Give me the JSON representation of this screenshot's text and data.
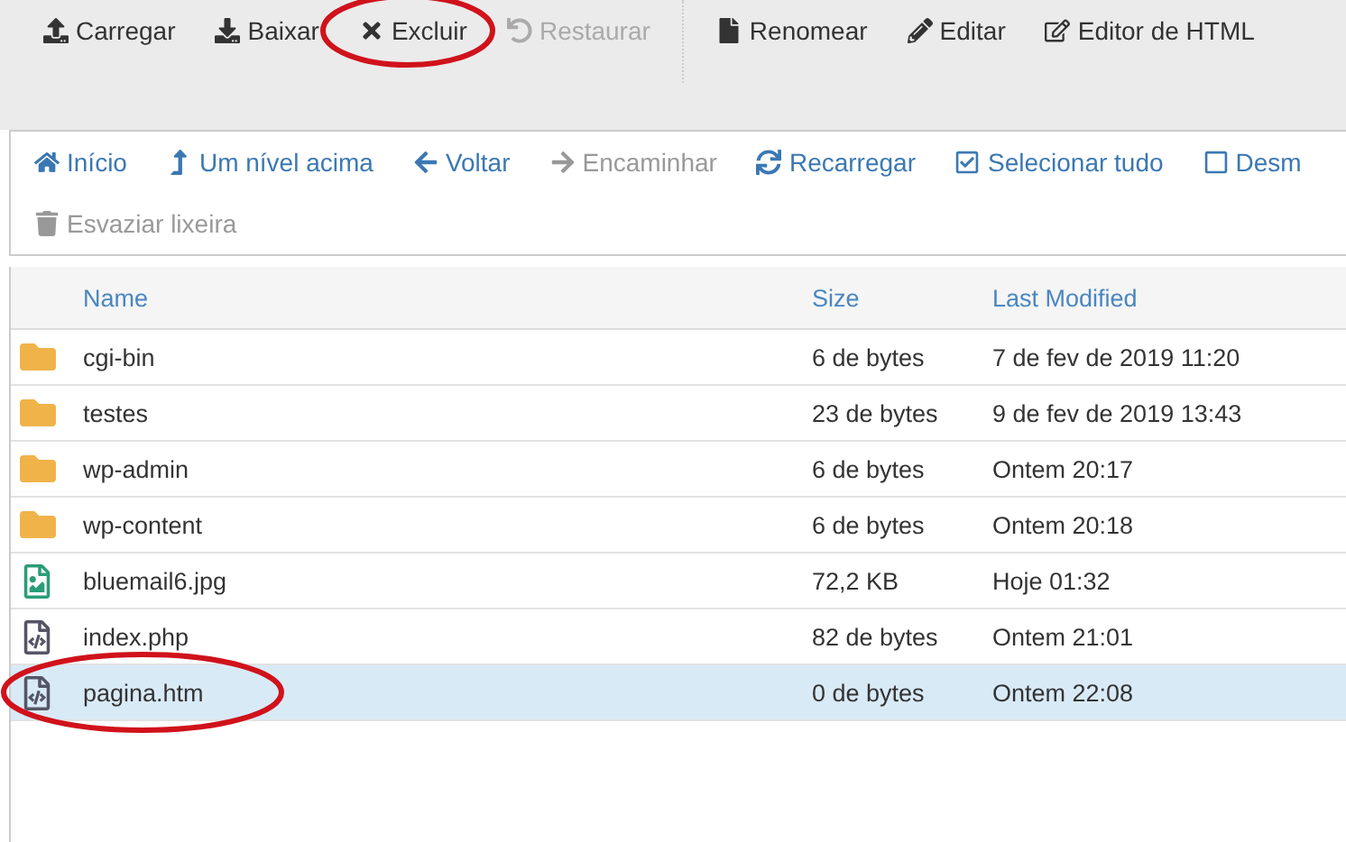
{
  "toolbar": [
    {
      "label": "Carregar",
      "disabled": false,
      "circled": false
    },
    {
      "label": "Baixar",
      "disabled": false,
      "circled": false
    },
    {
      "label": "Excluir",
      "disabled": false,
      "circled": true
    },
    {
      "label": "Restaurar",
      "disabled": true,
      "circled": false
    },
    {
      "label": "Renomear",
      "disabled": false,
      "circled": false
    },
    {
      "label": "Editar",
      "disabled": false,
      "circled": false
    },
    {
      "label": "Editor de HTML",
      "disabled": false,
      "circled": false
    }
  ],
  "navigation": {
    "rows": [
      [
        {
          "label": "Início",
          "disabled": false
        },
        {
          "label": "Um nível acima",
          "disabled": false
        },
        {
          "label": "Voltar",
          "disabled": false
        },
        {
          "label": "Encaminhar",
          "disabled": true
        },
        {
          "label": "Recarregar",
          "disabled": false
        },
        {
          "label": "Selecionar tudo",
          "disabled": false
        },
        {
          "label": "Desm",
          "disabled": false
        }
      ],
      [
        {
          "label": "Esvaziar lixeira",
          "disabled": true
        }
      ]
    ]
  },
  "table": {
    "columns": [
      "Name",
      "Size",
      "Last Modified"
    ],
    "rows": [
      {
        "kind": "folder",
        "name": "cgi-bin",
        "size": "6 de bytes",
        "modified": "7 de fev de 2019 11:20",
        "selected": false,
        "circled": false
      },
      {
        "kind": "folder",
        "name": "testes",
        "size": "23 de bytes",
        "modified": "9 de fev de 2019 13:43",
        "selected": false,
        "circled": false
      },
      {
        "kind": "folder",
        "name": "wp-admin",
        "size": "6 de bytes",
        "modified": "Ontem 20:17",
        "selected": false,
        "circled": false
      },
      {
        "kind": "folder",
        "name": "wp-content",
        "size": "6 de bytes",
        "modified": "Ontem 20:18",
        "selected": false,
        "circled": false
      },
      {
        "kind": "image",
        "name": "bluemail6.jpg",
        "size": "72,2 KB",
        "modified": "Hoje 01:32",
        "selected": false,
        "circled": false
      },
      {
        "kind": "code",
        "name": "index.php",
        "size": "82 de bytes",
        "modified": "Ontem 21:01",
        "selected": false,
        "circled": false
      },
      {
        "kind": "code",
        "name": "pagina.htm",
        "size": "0 de bytes",
        "modified": "Ontem 22:08",
        "selected": true,
        "circled": true
      }
    ]
  }
}
